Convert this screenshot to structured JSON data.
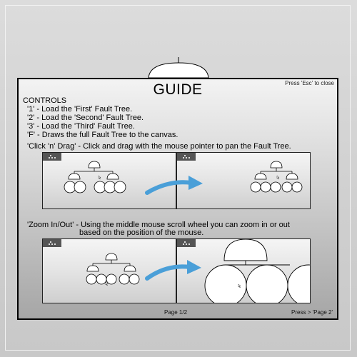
{
  "guide": {
    "title": "GUIDE",
    "esc_hint": "Press 'Esc' to close",
    "controls_heading": "CONTROLS",
    "controls": [
      "'1' - Load the 'First' Fault Tree.",
      "'2' - Load the 'Second' Fault Tree.",
      "'3' - Load the 'Third' Fault Tree.",
      "'F' - Draws the full Fault Tree to the canvas."
    ],
    "drag_desc": "'Click 'n' Drag' - Click and drag with the mouse pointer to pan the Fault Tree.",
    "zoom_desc_line1": "'Zoom In/Out' - Using the middle mouse scroll wheel you can zoom in or out",
    "zoom_desc_line2": "based on the position of the mouse.",
    "page_number": "Page 1/2",
    "next_hint": "Press > 'Page 2'"
  },
  "colors": {
    "arrow": "#4a9fd8",
    "corner_tag": "#555555",
    "frame": "#000000"
  },
  "icons": [
    "corner-tag-icon",
    "cursor-icon",
    "arrow-icon",
    "dome-icon"
  ]
}
